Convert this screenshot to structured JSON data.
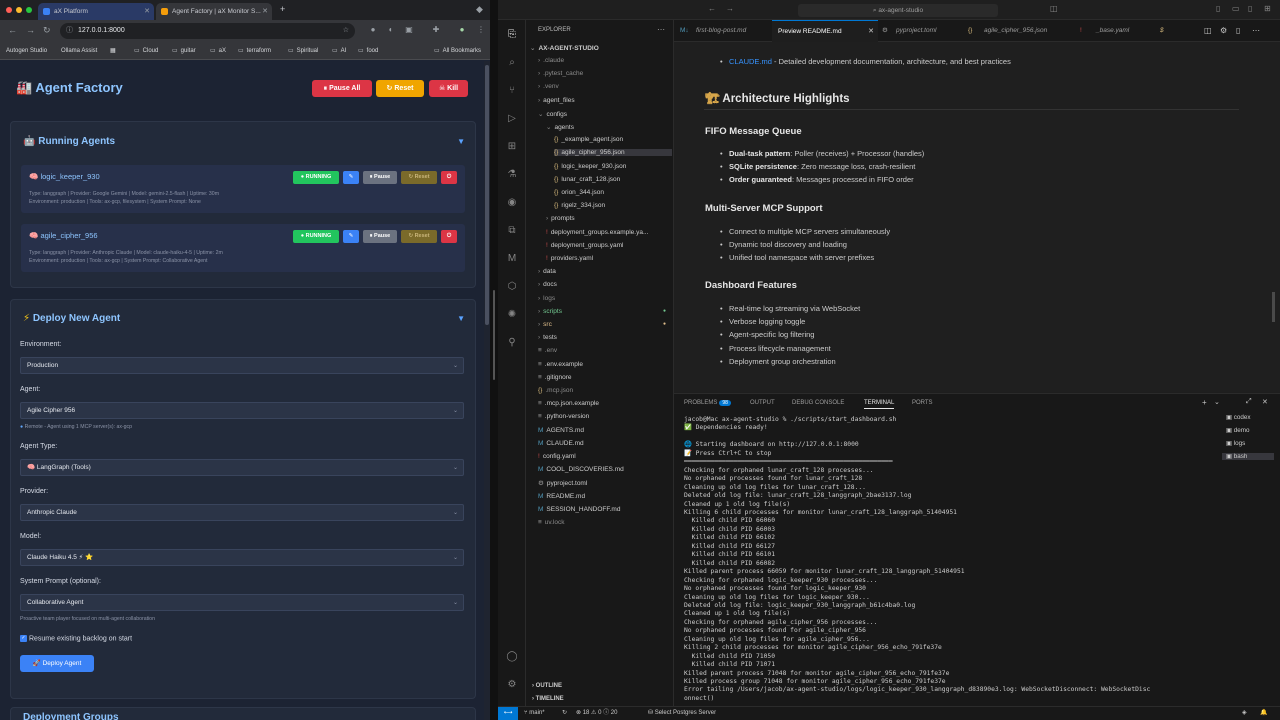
{
  "browser": {
    "tabs": [
      {
        "title": "aX Platform",
        "active": false
      },
      {
        "title": "Agent Factory | aX Monitor S...",
        "active": true
      }
    ],
    "address": "127.0.0.1:8000",
    "bookmarks": [
      "Autogen Studio",
      "Ollama Assist",
      "Cloud",
      "guitar",
      "aX",
      "terraform",
      "Spiritual",
      "AI",
      "food",
      "All Bookmarks"
    ]
  },
  "factory": {
    "title": "Agent Factory",
    "title_icon": "factory-icon",
    "header_buttons": {
      "pause_all": "Pause All",
      "reset": "Reset",
      "kill": "Kill"
    },
    "running": {
      "title": "Running Agents",
      "agents": [
        {
          "name": "logic_keeper_930",
          "status": "RUNNING",
          "meta_line1": "Type: langgraph | Provider: Google Gemini | Model: gemini-2.5-flash | Uptime: 30m",
          "meta_line2": "Environment: production | Tools: ax-gcp, filesystem | System Prompt: None",
          "pause_label": "Pause",
          "reset_label": "Reset"
        },
        {
          "name": "agile_cipher_956",
          "status": "RUNNING",
          "meta_line1": "Type: langgraph | Provider: Anthropic Claude | Model: claude-haiku-4-5 | Uptime: 2m",
          "meta_line2": "Environment: production | Tools: ax-gcp | System Prompt: Collaborative Agent",
          "pause_label": "Pause",
          "reset_label": "Reset"
        }
      ]
    },
    "deploy": {
      "title": "Deploy New Agent",
      "environment_label": "Environment:",
      "environment_value": "Production",
      "agent_label": "Agent:",
      "agent_value": "Agile Cipher 956",
      "agent_hint": "Remote - Agent using 1 MCP server(s): ax-gcp",
      "type_label": "Agent Type:",
      "type_value": "LangGraph (Tools)",
      "provider_label": "Provider:",
      "provider_value": "Anthropic Claude",
      "model_label": "Model:",
      "model_value": "Claude Haiku 4.5 ⚡ ⭐",
      "prompt_label": "System Prompt (optional):",
      "prompt_value": "Collaborative Agent",
      "prompt_hint": "Proactive team player focused on multi-agent collaboration",
      "resume_label": "Resume existing backlog on start",
      "resume_checked": true,
      "deploy_button": "Deploy Agent"
    },
    "next_section": "Deployment Groups"
  },
  "vscode": {
    "window_title": "ax-agent-studio",
    "explorer_title": "EXPLORER",
    "root": "AX-AGENT-STUDIO",
    "tree": [
      {
        "label": ".claude",
        "kind": "folder",
        "depth": 1,
        "style": "dim"
      },
      {
        "label": ".pytest_cache",
        "kind": "folder",
        "depth": 1,
        "style": "dim"
      },
      {
        "label": ".venv",
        "kind": "folder",
        "depth": 1,
        "style": "dim"
      },
      {
        "label": "agent_files",
        "kind": "folder",
        "depth": 1,
        "style": ""
      },
      {
        "label": "configs",
        "kind": "folder-open",
        "depth": 1,
        "style": ""
      },
      {
        "label": "agents",
        "kind": "folder-open",
        "depth": 2,
        "style": ""
      },
      {
        "label": "_example_agent.json",
        "kind": "json",
        "depth": 3,
        "style": ""
      },
      {
        "label": "agile_cipher_956.json",
        "kind": "json",
        "depth": 3,
        "style": "sel"
      },
      {
        "label": "logic_keeper_930.json",
        "kind": "json",
        "depth": 3,
        "style": ""
      },
      {
        "label": "lunar_craft_128.json",
        "kind": "json",
        "depth": 3,
        "style": ""
      },
      {
        "label": "orion_344.json",
        "kind": "json",
        "depth": 3,
        "style": ""
      },
      {
        "label": "rigelz_334.json",
        "kind": "json",
        "depth": 3,
        "style": ""
      },
      {
        "label": "prompts",
        "kind": "folder",
        "depth": 2,
        "style": ""
      },
      {
        "label": "deployment_groups.example.ya...",
        "kind": "yaml",
        "depth": 2,
        "style": ""
      },
      {
        "label": "deployment_groups.yaml",
        "kind": "yaml",
        "depth": 2,
        "style": ""
      },
      {
        "label": "providers.yaml",
        "kind": "yaml",
        "depth": 2,
        "style": ""
      },
      {
        "label": "data",
        "kind": "folder",
        "depth": 1,
        "style": ""
      },
      {
        "label": "docs",
        "kind": "folder",
        "depth": 1,
        "style": ""
      },
      {
        "label": "logs",
        "kind": "folder",
        "depth": 1,
        "style": "dim"
      },
      {
        "label": "scripts",
        "kind": "folder",
        "depth": 1,
        "style": "green"
      },
      {
        "label": "src",
        "kind": "folder",
        "depth": 1,
        "style": "orange"
      },
      {
        "label": "tests",
        "kind": "folder",
        "depth": 1,
        "style": ""
      },
      {
        "label": ".env",
        "kind": "file",
        "depth": 1,
        "style": "dim"
      },
      {
        "label": ".env.example",
        "kind": "file",
        "depth": 1,
        "style": ""
      },
      {
        "label": ".gitignore",
        "kind": "file",
        "depth": 1,
        "style": ""
      },
      {
        "label": ".mcp.json",
        "kind": "json",
        "depth": 1,
        "style": "dim"
      },
      {
        "label": ".mcp.json.example",
        "kind": "file",
        "depth": 1,
        "style": ""
      },
      {
        "label": ".python-version",
        "kind": "file",
        "depth": 1,
        "style": ""
      },
      {
        "label": "AGENTS.md",
        "kind": "md",
        "depth": 1,
        "style": ""
      },
      {
        "label": "CLAUDE.md",
        "kind": "md",
        "depth": 1,
        "style": ""
      },
      {
        "label": "config.yaml",
        "kind": "yaml",
        "depth": 1,
        "style": ""
      },
      {
        "label": "COOL_DISCOVERIES.md",
        "kind": "md",
        "depth": 1,
        "style": ""
      },
      {
        "label": "pyproject.toml",
        "kind": "toml",
        "depth": 1,
        "style": ""
      },
      {
        "label": "README.md",
        "kind": "md",
        "depth": 1,
        "style": ""
      },
      {
        "label": "SESSION_HANDOFF.md",
        "kind": "md",
        "depth": 1,
        "style": ""
      },
      {
        "label": "uv.lock",
        "kind": "file",
        "depth": 1,
        "style": "dim"
      }
    ],
    "outline": "OUTLINE",
    "timeline": "TIMELINE",
    "editor_tabs": [
      "first-blog-post.md",
      "Preview README.md",
      "pyproject.toml",
      "agile_cipher_956.json",
      "_base.yaml",
      "$"
    ],
    "readme": {
      "claude_link": "CLAUDE.md",
      "claude_desc": " - Detailed development documentation, architecture, and best practices",
      "arch_title": "Architecture Highlights",
      "fifo_title": "FIFO Message Queue",
      "fifo_items": [
        {
          "bold": "Dual-task pattern",
          "text": ": Poller (receives) + Processor (handles)"
        },
        {
          "bold": "SQLite persistence",
          "text": ": Zero message loss, crash-resilient"
        },
        {
          "bold": "Order guaranteed",
          "text": ": Messages processed in FIFO order"
        }
      ],
      "mcp_title": "Multi-Server MCP Support",
      "mcp_items": [
        "Connect to multiple MCP servers simultaneously",
        "Dynamic tool discovery and loading",
        "Unified tool namespace with server prefixes"
      ],
      "dash_title": "Dashboard Features",
      "dash_items": [
        "Real-time log streaming via WebSocket",
        "Verbose logging toggle",
        "Agent-specific log filtering",
        "Process lifecycle management",
        "Deployment group orchestration"
      ]
    },
    "panel_tabs": {
      "problems": "PROBLEMS",
      "problems_count": "98",
      "output": "OUTPUT",
      "debug": "DEBUG CONSOLE",
      "terminal": "TERMINAL",
      "ports": "PORTS"
    },
    "terminal_lines": [
      "jacob@Mac ax-agent-studio % ./scripts/start_dashboard.sh",
      "✅ Dependencies ready!",
      "",
      "🌐 Starting dashboard on http://127.0.0.1:8000",
      "📝 Press Ctrl+C to stop",
      "═══════════════════════════════════════════════════════",
      "Checking for orphaned lunar_craft_128 processes...",
      "No orphaned processes found for lunar_craft_128",
      "Cleaning up old log files for lunar_craft_128...",
      "Deleted old log file: lunar_craft_128_langgraph_2bae3137.log",
      "Cleaned up 1 old log file(s)",
      "Killing 6 child processes for monitor lunar_craft_128_langgraph_51404951",
      "  Killed child PID 66060",
      "  Killed child PID 66003",
      "  Killed child PID 66102",
      "  Killed child PID 66127",
      "  Killed child PID 66101",
      "  Killed child PID 66082",
      "Killed parent process 66059 for monitor lunar_craft_128_langgraph_51404951",
      "Checking for orphaned logic_keeper_930 processes...",
      "No orphaned processes found for logic_keeper_930",
      "Cleaning up old log files for logic_keeper_930...",
      "Deleted old log file: logic_keeper_930_langgraph_b61c4ba0.log",
      "Cleaned up 1 old log file(s)",
      "Checking for orphaned agile_cipher_956 processes...",
      "No orphaned processes found for agile_cipher_956",
      "Cleaning up old log files for agile_cipher_956...",
      "Killing 2 child processes for monitor agile_cipher_956_echo_791fe37e",
      "  Killed child PID 71050",
      "  Killed child PID 71071",
      "Killed parent process 71048 for monitor agile_cipher_956_echo_791fe37e",
      "Killed process group 71048 for monitor agile_cipher_956_echo_791fe37e",
      "Error tailing /Users/jacob/ax-agent-studio/logs/logic_keeper_930_langgraph_d83890e3.log: WebSocketDisconnect: WebSocketDisc",
      "onnect()"
    ],
    "terminal_list": [
      "codex",
      "demo",
      "logs",
      "bash"
    ],
    "status": {
      "branch": "main*",
      "problems": "⊗ 18  ⚠ 0  ⓘ 20",
      "server": "Select Postgres Server"
    }
  }
}
